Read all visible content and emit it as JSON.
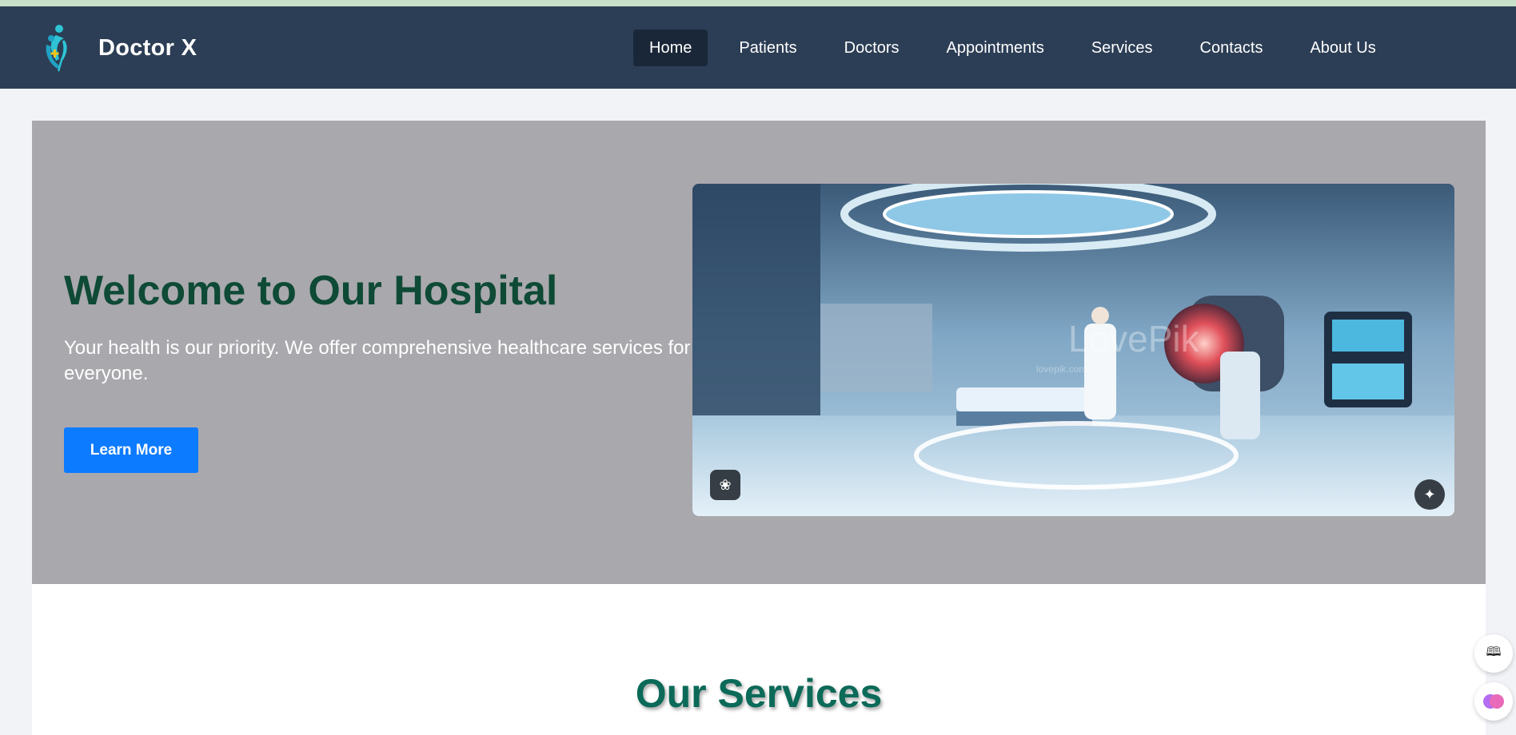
{
  "brand": {
    "name": "Doctor X",
    "logo_icon": "doctor-patient-logo"
  },
  "nav": {
    "items": [
      {
        "label": "Home",
        "active": true
      },
      {
        "label": "Patients",
        "active": false
      },
      {
        "label": "Doctors",
        "active": false
      },
      {
        "label": "Appointments",
        "active": false
      },
      {
        "label": "Services",
        "active": false
      },
      {
        "label": "Contacts",
        "active": false
      },
      {
        "label": "About Us",
        "active": false
      }
    ]
  },
  "hero": {
    "title": "Welcome to Our Hospital",
    "text": "Your health is our priority. We offer comprehensive healthcare services for everyone.",
    "button_label": "Learn More",
    "image_watermark": "LovePik",
    "image_watermark_sub": "lovepik.com"
  },
  "services": {
    "title": "Our Services"
  },
  "colors": {
    "navbar": "#2c3e55",
    "hero_bg": "#a9a8ad",
    "title_green": "#0e4a35",
    "button_blue": "#0d7bff",
    "services_title": "#0b6a58"
  }
}
